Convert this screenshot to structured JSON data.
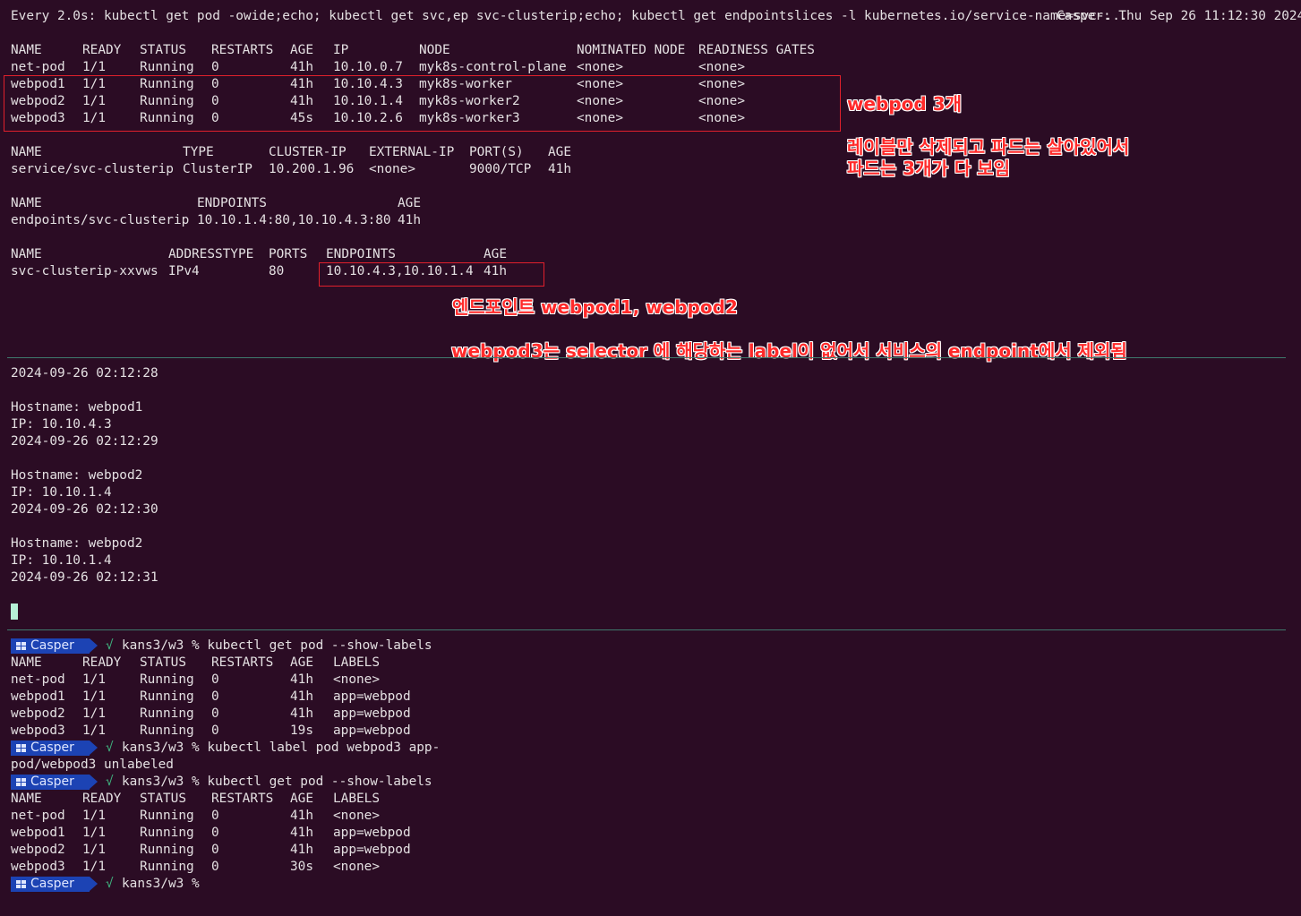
{
  "watch_header": {
    "command": "Every 2.0s: kubectl get pod -owide;echo; kubectl get svc,ep svc-clusterip;echo; kubectl get endpointslices -l kubernetes.io/service-name=svc-...",
    "host_time": "Casper: Thu Sep 26 11:12:30 2024"
  },
  "pods_wide": {
    "headers": [
      "NAME",
      "READY",
      "STATUS",
      "RESTARTS",
      "AGE",
      "IP",
      "NODE",
      "NOMINATED NODE",
      "READINESS GATES"
    ],
    "rows": [
      [
        "net-pod",
        "1/1",
        "Running",
        "0",
        "41h",
        "10.10.0.7",
        "myk8s-control-plane",
        "<none>",
        "<none>"
      ],
      [
        "webpod1",
        "1/1",
        "Running",
        "0",
        "41h",
        "10.10.4.3",
        "myk8s-worker",
        "<none>",
        "<none>"
      ],
      [
        "webpod2",
        "1/1",
        "Running",
        "0",
        "41h",
        "10.10.1.4",
        "myk8s-worker2",
        "<none>",
        "<none>"
      ],
      [
        "webpod3",
        "1/1",
        "Running",
        "0",
        "45s",
        "10.10.2.6",
        "myk8s-worker3",
        "<none>",
        "<none>"
      ]
    ]
  },
  "service": {
    "headers": [
      "NAME",
      "TYPE",
      "CLUSTER-IP",
      "EXTERNAL-IP",
      "PORT(S)",
      "AGE"
    ],
    "row": [
      "service/svc-clusterip",
      "ClusterIP",
      "10.200.1.96",
      "<none>",
      "9000/TCP",
      "41h"
    ]
  },
  "endpoints": {
    "headers": [
      "NAME",
      "ENDPOINTS",
      "AGE"
    ],
    "row": [
      "endpoints/svc-clusterip",
      "10.10.1.4:80,10.10.4.3:80",
      "41h"
    ]
  },
  "endpointslices": {
    "headers": [
      "NAME",
      "ADDRESSTYPE",
      "PORTS",
      "ENDPOINTS",
      "AGE"
    ],
    "row": [
      "svc-clusterip-xxvws",
      "IPv4",
      "80",
      "10.10.4.3,10.10.1.4",
      "41h"
    ]
  },
  "annotations": {
    "webpod_count": "webpod 3개",
    "labels_deleted_line1": "레이블만 삭제되고 파드는 살아있어서",
    "labels_deleted_line2": "파드는 3개가 다 보임",
    "endpoints_note": "엔드포인트 webpod1, webpod2",
    "excluded_note": "webpod3는 selector 에 해당하는 label이 없어서 서비스의 endpoint에서 제외됨"
  },
  "curl_log": [
    "2024-09-26 02:12:28",
    "",
    "Hostname: webpod1",
    "IP: 10.10.4.3",
    "2024-09-26 02:12:29",
    "",
    "Hostname: webpod2",
    "IP: 10.10.1.4",
    "2024-09-26 02:12:30",
    "",
    "Hostname: webpod2",
    "IP: 10.10.1.4",
    "2024-09-26 02:12:31"
  ],
  "prompt": {
    "user": "Casper",
    "check": "√",
    "path": "kans3/w3 %",
    "badge_color": "#1c43b4"
  },
  "shell": {
    "cmd1": "kubectl get pod --show-labels",
    "labels_headers": [
      "NAME",
      "READY",
      "STATUS",
      "RESTARTS",
      "AGE",
      "LABELS"
    ],
    "labels_before": [
      [
        "net-pod",
        "1/1",
        "Running",
        "0",
        "41h",
        "<none>"
      ],
      [
        "webpod1",
        "1/1",
        "Running",
        "0",
        "41h",
        "app=webpod"
      ],
      [
        "webpod2",
        "1/1",
        "Running",
        "0",
        "41h",
        "app=webpod"
      ],
      [
        "webpod3",
        "1/1",
        "Running",
        "0",
        "19s",
        "app=webpod"
      ]
    ],
    "cmd2": "kubectl label pod webpod3 app-",
    "cmd2_output": "pod/webpod3 unlabeled",
    "cmd3": "kubectl get pod --show-labels",
    "labels_after": [
      [
        "net-pod",
        "1/1",
        "Running",
        "0",
        "41h",
        "<none>"
      ],
      [
        "webpod1",
        "1/1",
        "Running",
        "0",
        "41h",
        "app=webpod"
      ],
      [
        "webpod2",
        "1/1",
        "Running",
        "0",
        "41h",
        "app=webpod"
      ],
      [
        "webpod3",
        "1/1",
        "Running",
        "0",
        "30s",
        "<none>"
      ]
    ]
  },
  "colors": {
    "background": "#2b0c24",
    "annotation_red": "#ff2a2a",
    "divider": "#3e7a6d",
    "cursor": "#b6f0d6"
  }
}
